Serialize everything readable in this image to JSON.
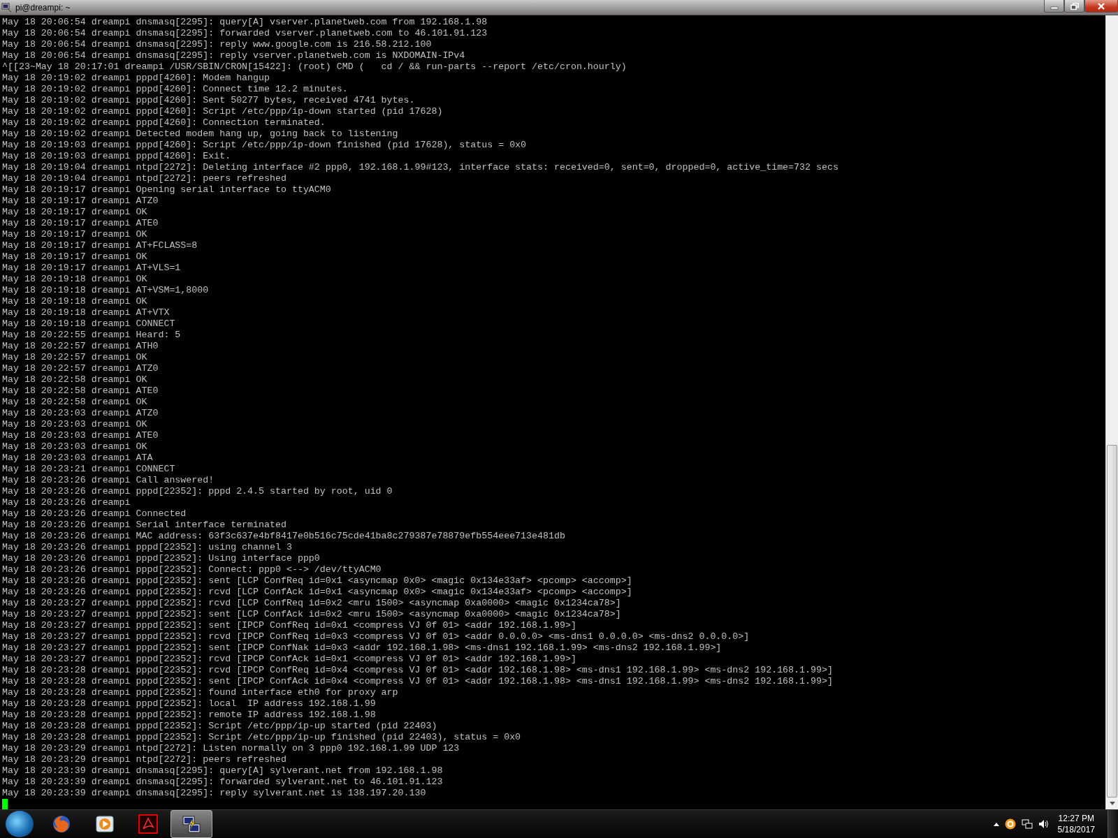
{
  "window": {
    "title": "pi@dreampi: ~"
  },
  "terminal": {
    "lines": [
      "May 18 20:06:54 dreampi dnsmasq[2295]: query[A] vserver.planetweb.com from 192.168.1.98",
      "May 18 20:06:54 dreampi dnsmasq[2295]: forwarded vserver.planetweb.com to 46.101.91.123",
      "May 18 20:06:54 dreampi dnsmasq[2295]: reply www.google.com is 216.58.212.100",
      "May 18 20:06:54 dreampi dnsmasq[2295]: reply vserver.planetweb.com is NXDOMAIN-IPv4",
      "^[[23~May 18 20:17:01 dreampi /USR/SBIN/CRON[15422]: (root) CMD (   cd / && run-parts --report /etc/cron.hourly)",
      "May 18 20:19:02 dreampi pppd[4260]: Modem hangup",
      "May 18 20:19:02 dreampi pppd[4260]: Connect time 12.2 minutes.",
      "May 18 20:19:02 dreampi pppd[4260]: Sent 50277 bytes, received 4741 bytes.",
      "May 18 20:19:02 dreampi pppd[4260]: Script /etc/ppp/ip-down started (pid 17628)",
      "May 18 20:19:02 dreampi pppd[4260]: Connection terminated.",
      "May 18 20:19:02 dreampi Detected modem hang up, going back to listening",
      "May 18 20:19:03 dreampi pppd[4260]: Script /etc/ppp/ip-down finished (pid 17628), status = 0x0",
      "May 18 20:19:03 dreampi pppd[4260]: Exit.",
      "May 18 20:19:04 dreampi ntpd[2272]: Deleting interface #2 ppp0, 192.168.1.99#123, interface stats: received=0, sent=0, dropped=0, active_time=732 secs",
      "May 18 20:19:04 dreampi ntpd[2272]: peers refreshed",
      "May 18 20:19:17 dreampi Opening serial interface to ttyACM0",
      "May 18 20:19:17 dreampi ATZ0",
      "May 18 20:19:17 dreampi OK",
      "May 18 20:19:17 dreampi ATE0",
      "May 18 20:19:17 dreampi OK",
      "May 18 20:19:17 dreampi AT+FCLASS=8",
      "May 18 20:19:17 dreampi OK",
      "May 18 20:19:17 dreampi AT+VLS=1",
      "May 18 20:19:18 dreampi OK",
      "May 18 20:19:18 dreampi AT+VSM=1,8000",
      "May 18 20:19:18 dreampi OK",
      "May 18 20:19:18 dreampi AT+VTX",
      "May 18 20:19:18 dreampi CONNECT",
      "May 18 20:22:55 dreampi Heard: 5",
      "May 18 20:22:57 dreampi ATH0",
      "May 18 20:22:57 dreampi OK",
      "May 18 20:22:57 dreampi ATZ0",
      "May 18 20:22:58 dreampi OK",
      "May 18 20:22:58 dreampi ATE0",
      "May 18 20:22:58 dreampi OK",
      "May 18 20:23:03 dreampi ATZ0",
      "May 18 20:23:03 dreampi OK",
      "May 18 20:23:03 dreampi ATE0",
      "May 18 20:23:03 dreampi OK",
      "May 18 20:23:03 dreampi ATA",
      "May 18 20:23:21 dreampi CONNECT",
      "May 18 20:23:26 dreampi Call answered!",
      "May 18 20:23:26 dreampi pppd[22352]: pppd 2.4.5 started by root, uid 0",
      "May 18 20:23:26 dreampi",
      "May 18 20:23:26 dreampi Connected",
      "May 18 20:23:26 dreampi Serial interface terminated",
      "May 18 20:23:26 dreampi MAC address: 63f3c637e4bf8417e0b516c75cde41ba8c279387e78879efb554eee713e481db",
      "May 18 20:23:26 dreampi pppd[22352]: using channel 3",
      "May 18 20:23:26 dreampi pppd[22352]: Using interface ppp0",
      "May 18 20:23:26 dreampi pppd[22352]: Connect: ppp0 <--> /dev/ttyACM0",
      "May 18 20:23:26 dreampi pppd[22352]: sent [LCP ConfReq id=0x1 <asyncmap 0x0> <magic 0x134e33af> <pcomp> <accomp>]",
      "May 18 20:23:26 dreampi pppd[22352]: rcvd [LCP ConfAck id=0x1 <asyncmap 0x0> <magic 0x134e33af> <pcomp> <accomp>]",
      "May 18 20:23:27 dreampi pppd[22352]: rcvd [LCP ConfReq id=0x2 <mru 1500> <asyncmap 0xa0000> <magic 0x1234ca78>]",
      "May 18 20:23:27 dreampi pppd[22352]: sent [LCP ConfAck id=0x2 <mru 1500> <asyncmap 0xa0000> <magic 0x1234ca78>]",
      "May 18 20:23:27 dreampi pppd[22352]: sent [IPCP ConfReq id=0x1 <compress VJ 0f 01> <addr 192.168.1.99>]",
      "May 18 20:23:27 dreampi pppd[22352]: rcvd [IPCP ConfReq id=0x3 <compress VJ 0f 01> <addr 0.0.0.0> <ms-dns1 0.0.0.0> <ms-dns2 0.0.0.0>]",
      "May 18 20:23:27 dreampi pppd[22352]: sent [IPCP ConfNak id=0x3 <addr 192.168.1.98> <ms-dns1 192.168.1.99> <ms-dns2 192.168.1.99>]",
      "May 18 20:23:27 dreampi pppd[22352]: rcvd [IPCP ConfAck id=0x1 <compress VJ 0f 01> <addr 192.168.1.99>]",
      "May 18 20:23:28 dreampi pppd[22352]: rcvd [IPCP ConfReq id=0x4 <compress VJ 0f 01> <addr 192.168.1.98> <ms-dns1 192.168.1.99> <ms-dns2 192.168.1.99>]",
      "May 18 20:23:28 dreampi pppd[22352]: sent [IPCP ConfAck id=0x4 <compress VJ 0f 01> <addr 192.168.1.98> <ms-dns1 192.168.1.99> <ms-dns2 192.168.1.99>]",
      "May 18 20:23:28 dreampi pppd[22352]: found interface eth0 for proxy arp",
      "May 18 20:23:28 dreampi pppd[22352]: local  IP address 192.168.1.99",
      "May 18 20:23:28 dreampi pppd[22352]: remote IP address 192.168.1.98",
      "May 18 20:23:28 dreampi pppd[22352]: Script /etc/ppp/ip-up started (pid 22403)",
      "May 18 20:23:28 dreampi pppd[22352]: Script /etc/ppp/ip-up finished (pid 22403), status = 0x0",
      "May 18 20:23:29 dreampi ntpd[2272]: Listen normally on 3 ppp0 192.168.1.99 UDP 123",
      "May 18 20:23:29 dreampi ntpd[2272]: peers refreshed",
      "May 18 20:23:39 dreampi dnsmasq[2295]: query[A] sylverant.net from 192.168.1.98",
      "May 18 20:23:39 dreampi dnsmasq[2295]: forwarded sylverant.net to 46.101.91.123",
      "May 18 20:23:39 dreampi dnsmasq[2295]: reply sylverant.net is 138.197.20.130"
    ]
  },
  "taskbar": {
    "items": [
      {
        "kind": "browser",
        "selected": false
      },
      {
        "kind": "media",
        "selected": false
      },
      {
        "kind": "pdf",
        "selected": false
      },
      {
        "kind": "terminal",
        "selected": true
      }
    ],
    "clock": {
      "time": "12:27 PM",
      "date": "5/18/2017"
    }
  }
}
